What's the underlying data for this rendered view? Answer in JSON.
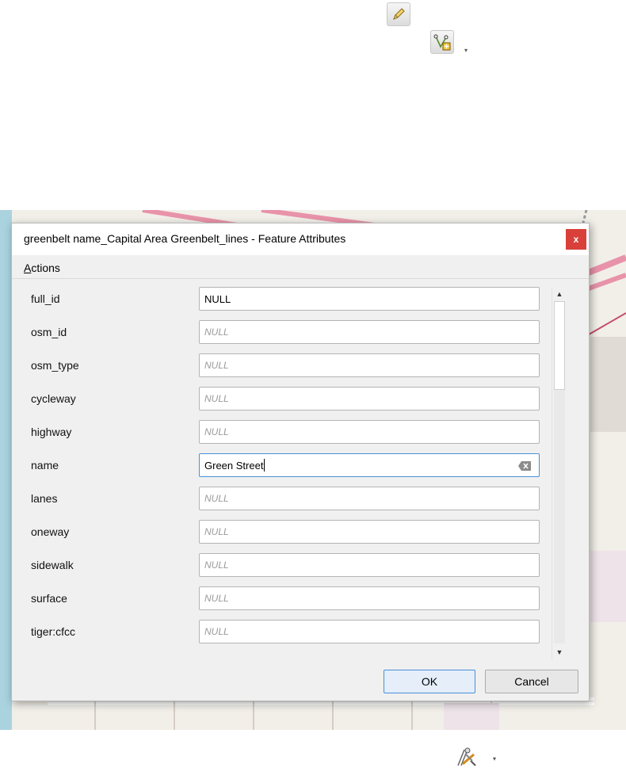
{
  "toolbar": {
    "edit_icon": "pencil-icon",
    "vertex_tool_icon": "vertex-tool-icon",
    "advanced_digitizing_icon": "digitizing-tools-icon"
  },
  "dialog": {
    "title": "greenbelt name_Capital Area Greenbelt_lines - Feature Attributes",
    "close_label": "x",
    "menu": {
      "actions_mnemonic": "A",
      "actions_rest": "ctions"
    },
    "fields": [
      {
        "label": "full_id",
        "value": "NULL"
      },
      {
        "label": "osm_id",
        "value": "NULL"
      },
      {
        "label": "osm_type",
        "value": "NULL"
      },
      {
        "label": "cycleway",
        "value": "NULL"
      },
      {
        "label": "highway",
        "value": "NULL"
      },
      {
        "label": "name",
        "value": "Green Street"
      },
      {
        "label": "lanes",
        "value": "NULL"
      },
      {
        "label": "oneway",
        "value": "NULL"
      },
      {
        "label": "sidewalk",
        "value": "NULL"
      },
      {
        "label": "surface",
        "value": "NULL"
      },
      {
        "label": "tiger:cfcc",
        "value": "NULL"
      }
    ],
    "ok_label": "OK",
    "cancel_label": "Cancel"
  },
  "colors": {
    "close_button": "#d9403a",
    "map_road_pink": "#e893a9",
    "focus_border": "#4a90d9"
  }
}
